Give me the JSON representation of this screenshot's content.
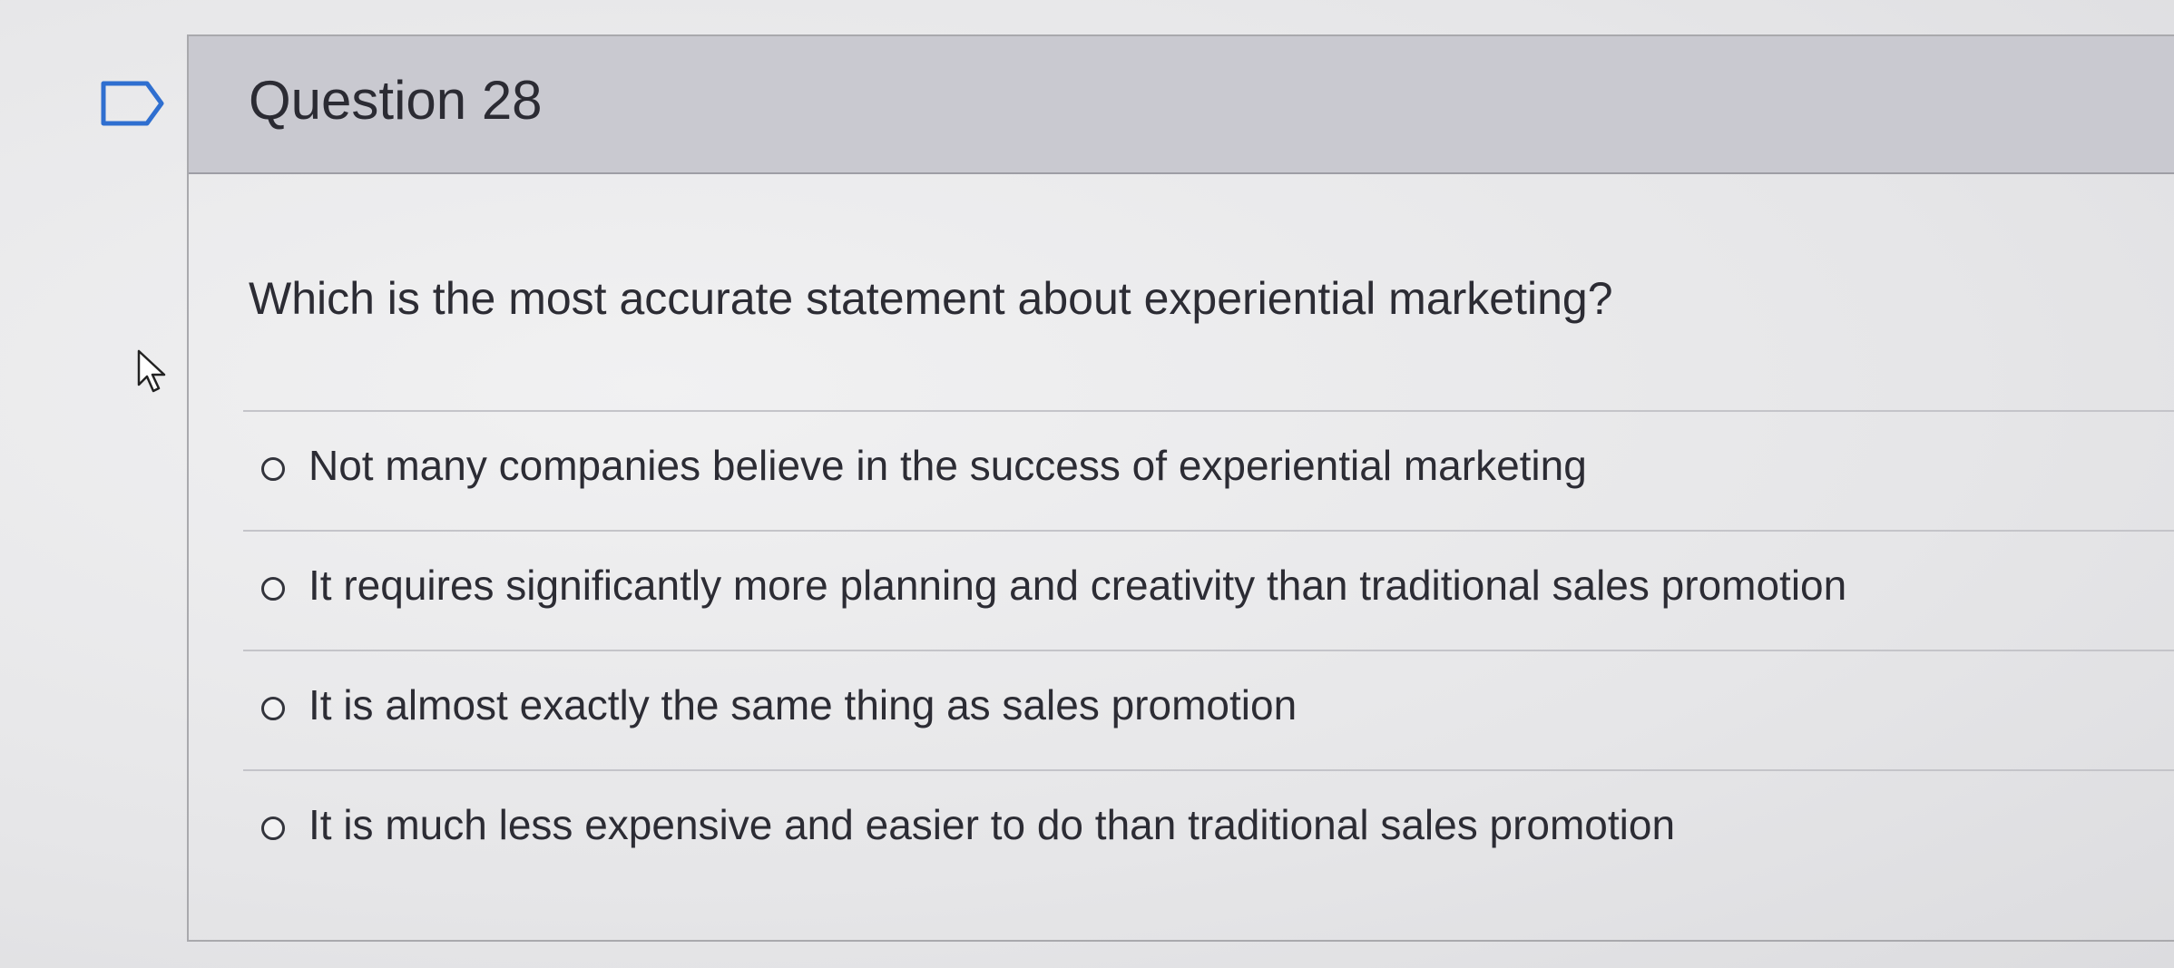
{
  "question": {
    "title": "Question 28",
    "prompt": "Which is the most accurate statement about experiential marketing?",
    "answers": [
      {
        "label": "Not many companies believe in the success of experiential marketing",
        "selected": false
      },
      {
        "label": "It requires significantly more planning and creativity than traditional sales promotion",
        "selected": false
      },
      {
        "label": "It is almost exactly the same thing as sales promotion",
        "selected": false
      },
      {
        "label": "It is much less expensive and easier to do than traditional sales promotion",
        "selected": false
      }
    ]
  },
  "icons": {
    "flag": "flag-outline-icon",
    "cursor": "mouse-pointer-icon"
  },
  "colors": {
    "header_bg": "#c9c9d0",
    "text": "#2c2c34",
    "border": "#a9a9ad"
  }
}
